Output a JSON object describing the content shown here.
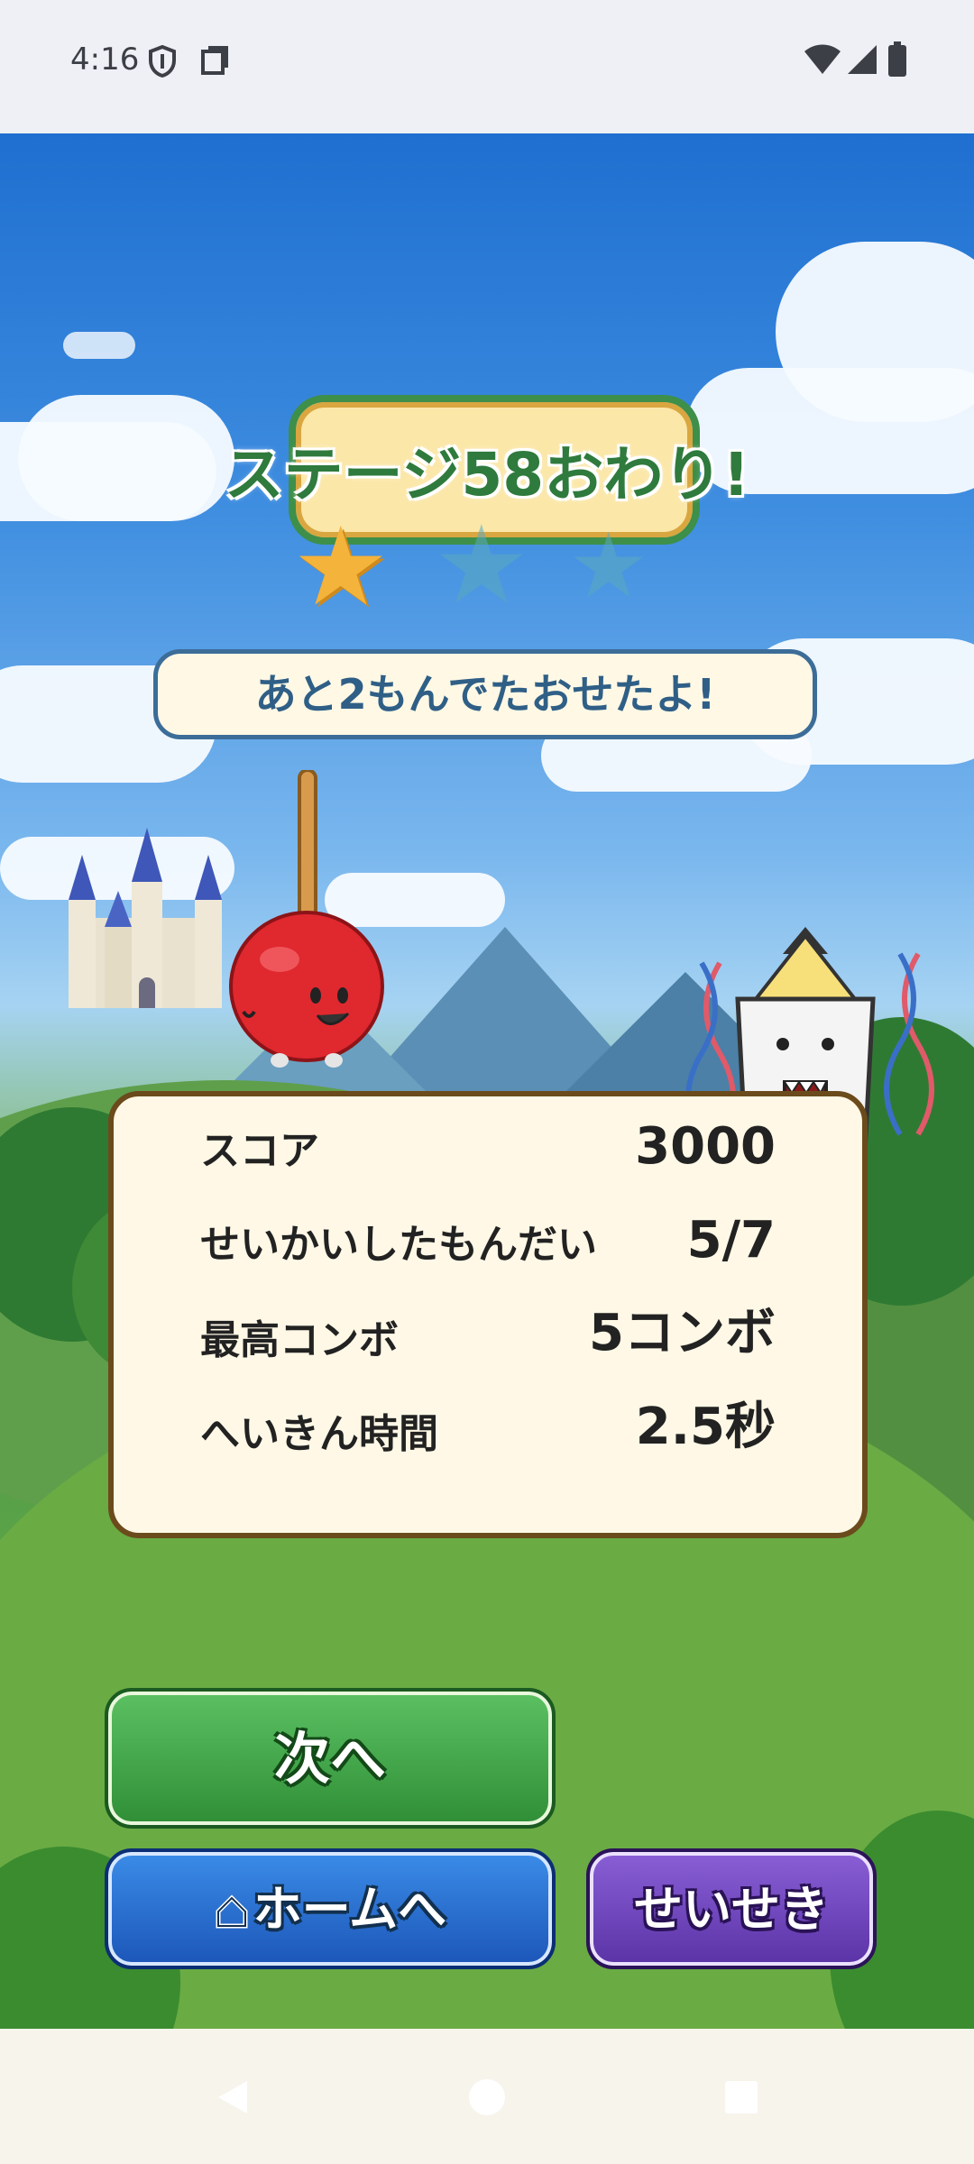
{
  "status_bar": {
    "time": "4:16",
    "icons": [
      "shield-icon",
      "screen-icon",
      "wifi-icon",
      "cell-signal-icon",
      "battery-icon"
    ]
  },
  "result": {
    "title": "ステージ58おわり!",
    "stars_earned": 1,
    "stars_total": 3,
    "message": "あと2もんでたおせたよ!"
  },
  "stats": {
    "score_label": "スコア",
    "score_value": "3000",
    "correct_label": "せいかいしたもんだい",
    "correct_value": "5/7",
    "combo_label": "最高コンボ",
    "combo_value": "5コンボ",
    "avg_time_label": "へいきん時間",
    "avg_time_value": "2.5秒"
  },
  "buttons": {
    "next": "次へ",
    "home": "ホームへ",
    "record": "せいせき"
  },
  "colors": {
    "title_green": "#2f7a3d",
    "next_green": "#2f8e36",
    "home_blue": "#1c56b8",
    "record_purple": "#5a33a6",
    "panel_bg": "#fff8e6"
  }
}
